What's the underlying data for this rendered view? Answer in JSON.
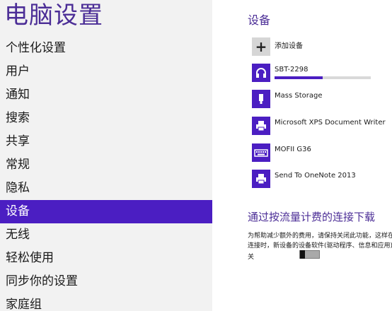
{
  "app_title": "电脑设置",
  "nav": {
    "items": [
      "个性化设置",
      "用户",
      "通知",
      "搜索",
      "共享",
      "常规",
      "隐私",
      "设备",
      "无线",
      "轻松使用",
      "同步你的设置",
      "家庭组"
    ],
    "selected_index": 7
  },
  "devices_section": {
    "title": "设备",
    "add_label": "添加设备",
    "devices": [
      {
        "name": "SBT-2298",
        "icon": "headset-icon",
        "progress": 0.5
      },
      {
        "name": "Mass Storage",
        "icon": "usb-drive-icon"
      },
      {
        "name": "Microsoft XPS Document Writer",
        "icon": "printer-icon"
      },
      {
        "name": "MOFII G36",
        "icon": "keyboard-icon"
      },
      {
        "name": "Send To OneNote 2013",
        "icon": "printer-icon"
      }
    ]
  },
  "metered": {
    "title": "通过按流量计费的连接下载",
    "description_line1": "为帮助减少额外的费用，请保持关闭此功能，这样在使用按流量计费的",
    "description_line2": "连接时，新设备的设备软件(驱动程序、信息和应用)将不会下载。",
    "toggle_label": "关",
    "toggle_on": false
  },
  "colors": {
    "accent": "#4b1ec2",
    "title": "#4b2d96",
    "nav_bg": "#f2f2f2"
  }
}
